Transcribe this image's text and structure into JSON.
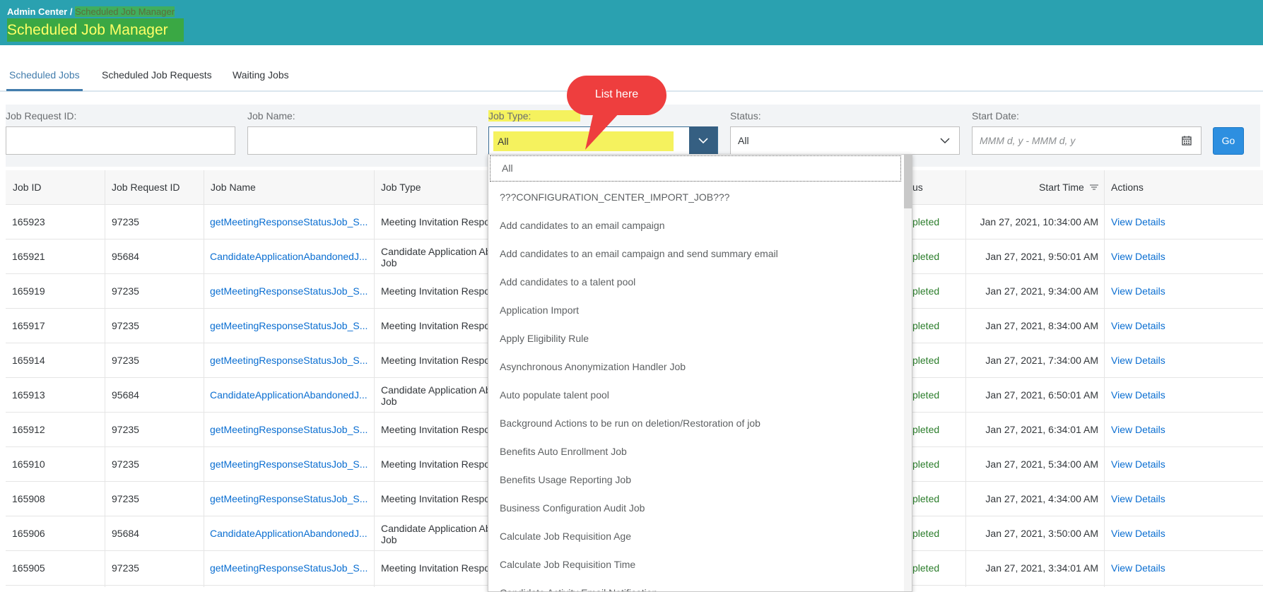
{
  "header": {
    "breadcrumb_root": "Admin Center /",
    "breadcrumb_current": "Scheduled Job Manager",
    "title": "Scheduled Job Manager"
  },
  "tabs": [
    {
      "label": "Scheduled Jobs",
      "active": true
    },
    {
      "label": "Scheduled Job Requests",
      "active": false
    },
    {
      "label": "Waiting Jobs",
      "active": false
    }
  ],
  "filters": {
    "job_request_id_label": "Job Request ID:",
    "job_name_label": "Job Name:",
    "job_type_label": "Job Type:",
    "job_type_value": "All",
    "status_label": "Status:",
    "status_value": "All",
    "start_date_label": "Start Date:",
    "start_date_placeholder": "MMM d, y - MMM d, y",
    "go_label": "Go"
  },
  "callout": {
    "text": "List here"
  },
  "table": {
    "headers": {
      "job_id": "Job ID",
      "job_request_id": "Job Request ID",
      "job_name": "Job Name",
      "job_type": "Job Type",
      "status": "us",
      "start_time": "Start Time",
      "actions": "Actions"
    },
    "rows": [
      {
        "job_id": "165923",
        "req": "97235",
        "name": "getMeetingResponseStatusJob_S...",
        "type1": "Meeting Invitation Respo",
        "type2": "",
        "status": "pleted",
        "start": "Jan 27, 2021, 10:34:00 AM",
        "action": "View Details"
      },
      {
        "job_id": "165921",
        "req": "95684",
        "name": "CandidateApplicationAbandonedJ...",
        "type1": "Candidate Application Ab",
        "type2": "Job",
        "status": "pleted",
        "start": "Jan 27, 2021, 9:50:01 AM",
        "action": "View Details"
      },
      {
        "job_id": "165919",
        "req": "97235",
        "name": "getMeetingResponseStatusJob_S...",
        "type1": "Meeting Invitation Respo",
        "type2": "",
        "status": "pleted",
        "start": "Jan 27, 2021, 9:34:00 AM",
        "action": "View Details"
      },
      {
        "job_id": "165917",
        "req": "97235",
        "name": "getMeetingResponseStatusJob_S...",
        "type1": "Meeting Invitation Respo",
        "type2": "",
        "status": "pleted",
        "start": "Jan 27, 2021, 8:34:00 AM",
        "action": "View Details"
      },
      {
        "job_id": "165914",
        "req": "97235",
        "name": "getMeetingResponseStatusJob_S...",
        "type1": "Meeting Invitation Respo",
        "type2": "",
        "status": "pleted",
        "start": "Jan 27, 2021, 7:34:00 AM",
        "action": "View Details"
      },
      {
        "job_id": "165913",
        "req": "95684",
        "name": "CandidateApplicationAbandonedJ...",
        "type1": "Candidate Application Ab",
        "type2": "Job",
        "status": "pleted",
        "start": "Jan 27, 2021, 6:50:01 AM",
        "action": "View Details"
      },
      {
        "job_id": "165912",
        "req": "97235",
        "name": "getMeetingResponseStatusJob_S...",
        "type1": "Meeting Invitation Respo",
        "type2": "",
        "status": "pleted",
        "start": "Jan 27, 2021, 6:34:01 AM",
        "action": "View Details"
      },
      {
        "job_id": "165910",
        "req": "97235",
        "name": "getMeetingResponseStatusJob_S...",
        "type1": "Meeting Invitation Respo",
        "type2": "",
        "status": "pleted",
        "start": "Jan 27, 2021, 5:34:00 AM",
        "action": "View Details"
      },
      {
        "job_id": "165908",
        "req": "97235",
        "name": "getMeetingResponseStatusJob_S...",
        "type1": "Meeting Invitation Respo",
        "type2": "",
        "status": "pleted",
        "start": "Jan 27, 2021, 4:34:00 AM",
        "action": "View Details"
      },
      {
        "job_id": "165906",
        "req": "95684",
        "name": "CandidateApplicationAbandonedJ...",
        "type1": "Candidate Application Ab",
        "type2": "Job",
        "status": "pleted",
        "start": "Jan 27, 2021, 3:50:00 AM",
        "action": "View Details"
      },
      {
        "job_id": "165905",
        "req": "97235",
        "name": "getMeetingResponseStatusJob_S...",
        "type1": "Meeting Invitation Respo",
        "type2": "",
        "status": "pleted",
        "start": "Jan 27, 2021, 3:34:01 AM",
        "action": "View Details"
      }
    ]
  },
  "job_type_options": [
    "All",
    "???CONFIGURATION_CENTER_IMPORT_JOB???",
    "Add candidates to an email campaign",
    "Add candidates to an email campaign and send summary email",
    "Add candidates to a talent pool",
    "Application Import",
    "Apply Eligibility Rule",
    "Asynchronous Anonymization Handler Job",
    "Auto populate talent pool",
    "Background Actions to be run on deletion/Restoration of job",
    "Benefits Auto Enrollment Job",
    "Benefits Usage Reporting Job",
    "Business Configuration Audit Job",
    "Calculate Job Requisition Age",
    "Calculate Job Requisition Time",
    "Candidate Activity Email Notification"
  ],
  "colors": {
    "header": "#2aa1b0",
    "accent_link": "#0a6ed1",
    "go_button": "#2d8fe0",
    "highlight": "#f5f25e",
    "callout": "#ee3e3e",
    "status_ok": "#2b7d2b"
  },
  "icons": {
    "job_type_dropdown": "chevron-down-icon",
    "status_dropdown": "chevron-down-icon",
    "date_picker": "calendar-icon",
    "sort": "sort-icon"
  }
}
